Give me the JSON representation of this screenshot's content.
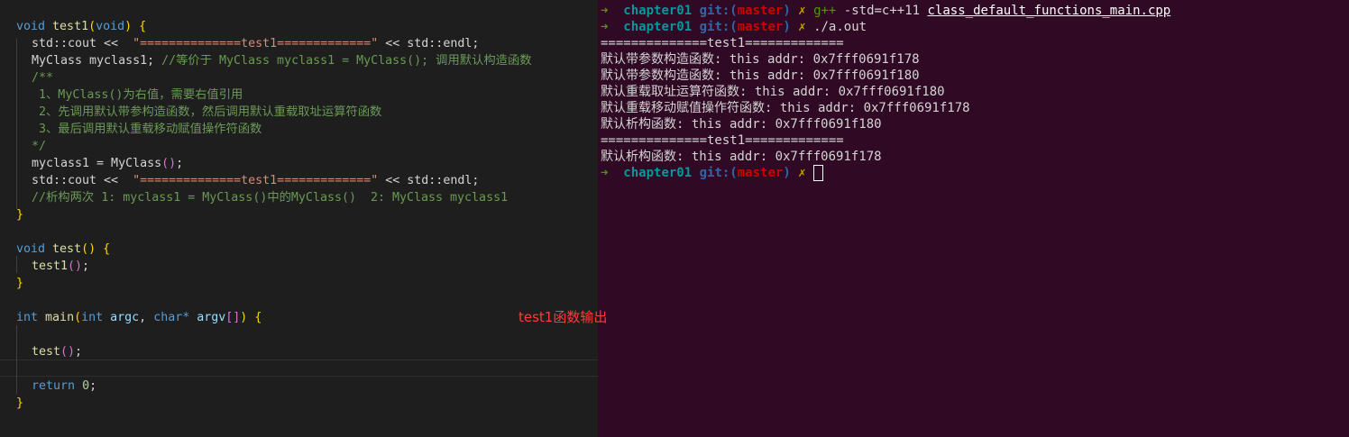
{
  "editor": {
    "lines": [
      {
        "indent": 0,
        "tokens": [
          {
            "c": "kw",
            "t": "void"
          },
          {
            "c": "pl",
            "t": " "
          },
          {
            "c": "fn",
            "t": "test1"
          },
          {
            "c": "br1",
            "t": "("
          },
          {
            "c": "kw",
            "t": "void"
          },
          {
            "c": "br1",
            "t": ")"
          },
          {
            "c": "pl",
            "t": " "
          },
          {
            "c": "br1",
            "t": "{"
          }
        ]
      },
      {
        "indent": 1,
        "tokens": [
          {
            "c": "pl",
            "t": "std::cout <<  "
          },
          {
            "c": "str",
            "t": "\"==============test1=============\""
          },
          {
            "c": "pl",
            "t": " << std::endl;"
          }
        ]
      },
      {
        "indent": 1,
        "tokens": [
          {
            "c": "pl",
            "t": "MyClass myclass1; "
          },
          {
            "c": "cm",
            "t": "//等价于 MyClass myclass1 = MyClass(); 调用默认构造函数"
          }
        ]
      },
      {
        "indent": 1,
        "tokens": [
          {
            "c": "cm",
            "t": "/**"
          }
        ]
      },
      {
        "indent": 1,
        "tokens": [
          {
            "c": "cm",
            "t": " 1、MyClass()为右值，需要右值引用"
          }
        ]
      },
      {
        "indent": 1,
        "tokens": [
          {
            "c": "cm",
            "t": " 2、先调用默认带参构造函数，然后调用默认重载取址运算符函数"
          }
        ]
      },
      {
        "indent": 1,
        "tokens": [
          {
            "c": "cm",
            "t": " 3、最后调用默认重载移动赋值操作符函数"
          }
        ]
      },
      {
        "indent": 1,
        "tokens": [
          {
            "c": "cm",
            "t": "*/"
          }
        ]
      },
      {
        "indent": 1,
        "tokens": [
          {
            "c": "pl",
            "t": "myclass1 = MyClass"
          },
          {
            "c": "br2",
            "t": "()"
          },
          {
            "c": "pl",
            "t": ";"
          }
        ]
      },
      {
        "indent": 1,
        "tokens": [
          {
            "c": "pl",
            "t": "std::cout <<  "
          },
          {
            "c": "str",
            "t": "\"==============test1=============\""
          },
          {
            "c": "pl",
            "t": " << std::endl;"
          }
        ]
      },
      {
        "indent": 1,
        "tokens": [
          {
            "c": "cm",
            "t": "//析构两次 1: myclass1 = MyClass()中的MyClass()  2: MyClass myclass1"
          }
        ]
      },
      {
        "indent": 0,
        "tokens": [
          {
            "c": "br1",
            "t": "}"
          }
        ]
      },
      {
        "indent": 0,
        "tokens": []
      },
      {
        "indent": 0,
        "tokens": [
          {
            "c": "kw",
            "t": "void"
          },
          {
            "c": "pl",
            "t": " "
          },
          {
            "c": "fn",
            "t": "test"
          },
          {
            "c": "br1",
            "t": "()"
          },
          {
            "c": "pl",
            "t": " "
          },
          {
            "c": "br1",
            "t": "{"
          }
        ]
      },
      {
        "indent": 1,
        "tokens": [
          {
            "c": "fn",
            "t": "test1"
          },
          {
            "c": "br2",
            "t": "()"
          },
          {
            "c": "pl",
            "t": ";"
          }
        ]
      },
      {
        "indent": 0,
        "tokens": [
          {
            "c": "br1",
            "t": "}"
          }
        ]
      },
      {
        "indent": 0,
        "tokens": []
      },
      {
        "indent": 0,
        "tokens": [
          {
            "c": "kw",
            "t": "int"
          },
          {
            "c": "pl",
            "t": " "
          },
          {
            "c": "fn",
            "t": "main"
          },
          {
            "c": "br1",
            "t": "("
          },
          {
            "c": "kw",
            "t": "int"
          },
          {
            "c": "pl",
            "t": " "
          },
          {
            "c": "var",
            "t": "argc"
          },
          {
            "c": "pl",
            "t": ", "
          },
          {
            "c": "kw",
            "t": "char"
          },
          {
            "c": "kw",
            "t": "*"
          },
          {
            "c": "pl",
            "t": " "
          },
          {
            "c": "var",
            "t": "argv"
          },
          {
            "c": "br2",
            "t": "[]"
          },
          {
            "c": "br1",
            "t": ")"
          },
          {
            "c": "pl",
            "t": " "
          },
          {
            "c": "br1",
            "t": "{"
          }
        ]
      },
      {
        "indent": 1,
        "tokens": []
      },
      {
        "indent": 1,
        "tokens": [
          {
            "c": "fn",
            "t": "test"
          },
          {
            "c": "br2",
            "t": "()"
          },
          {
            "c": "pl",
            "t": ";"
          }
        ]
      },
      {
        "indent": 1,
        "tokens": []
      },
      {
        "indent": 1,
        "tokens": [
          {
            "c": "kw",
            "t": "return"
          },
          {
            "c": "pl",
            "t": " "
          },
          {
            "c": "num",
            "t": "0"
          },
          {
            "c": "pl",
            "t": ";"
          }
        ]
      },
      {
        "indent": 0,
        "tokens": [
          {
            "c": "br1",
            "t": "}"
          }
        ]
      }
    ]
  },
  "annotation": "test1函数输出",
  "terminal": {
    "lines": [
      {
        "tokens": [
          {
            "c": "arrow",
            "t": "➜  "
          },
          {
            "c": "dir",
            "t": "chapter01"
          },
          {
            "c": "pl",
            "t": " "
          },
          {
            "c": "git",
            "t": "git:("
          },
          {
            "c": "br",
            "t": "master"
          },
          {
            "c": "git",
            "t": ")"
          },
          {
            "c": "pl",
            "t": " "
          },
          {
            "c": "x",
            "t": "✗ "
          },
          {
            "c": "cmdg",
            "t": "g++"
          },
          {
            "c": "pl",
            "t": " -std=c++11 "
          },
          {
            "c": "ul",
            "t": "class_default_functions_main.cpp"
          }
        ]
      },
      {
        "tokens": [
          {
            "c": "arrow",
            "t": "➜  "
          },
          {
            "c": "dir",
            "t": "chapter01"
          },
          {
            "c": "pl",
            "t": " "
          },
          {
            "c": "git",
            "t": "git:("
          },
          {
            "c": "br",
            "t": "master"
          },
          {
            "c": "git",
            "t": ")"
          },
          {
            "c": "pl",
            "t": " "
          },
          {
            "c": "x",
            "t": "✗ "
          },
          {
            "c": "pl",
            "t": "./a.out"
          }
        ]
      },
      {
        "tokens": [
          {
            "c": "pl",
            "t": "==============test1============="
          }
        ]
      },
      {
        "tokens": [
          {
            "c": "pl",
            "t": "默认带参数构造函数: this addr: 0x7fff0691f178"
          }
        ]
      },
      {
        "tokens": [
          {
            "c": "pl",
            "t": "默认带参数构造函数: this addr: 0x7fff0691f180"
          }
        ]
      },
      {
        "tokens": [
          {
            "c": "pl",
            "t": "默认重载取址运算符函数: this addr: 0x7fff0691f180"
          }
        ]
      },
      {
        "tokens": [
          {
            "c": "pl",
            "t": "默认重载移动赋值操作符函数: this addr: 0x7fff0691f178"
          }
        ]
      },
      {
        "tokens": [
          {
            "c": "pl",
            "t": "默认析构函数: this addr: 0x7fff0691f180"
          }
        ]
      },
      {
        "tokens": [
          {
            "c": "pl",
            "t": "==============test1============="
          }
        ]
      },
      {
        "tokens": [
          {
            "c": "pl",
            "t": "默认析构函数: this addr: 0x7fff0691f178"
          }
        ]
      },
      {
        "tokens": [
          {
            "c": "arrow",
            "t": "➜  "
          },
          {
            "c": "dir",
            "t": "chapter01"
          },
          {
            "c": "pl",
            "t": " "
          },
          {
            "c": "git",
            "t": "git:("
          },
          {
            "c": "br",
            "t": "master"
          },
          {
            "c": "git",
            "t": ")"
          },
          {
            "c": "pl",
            "t": " "
          },
          {
            "c": "x",
            "t": "✗ "
          }
        ],
        "cursor": true
      }
    ]
  }
}
